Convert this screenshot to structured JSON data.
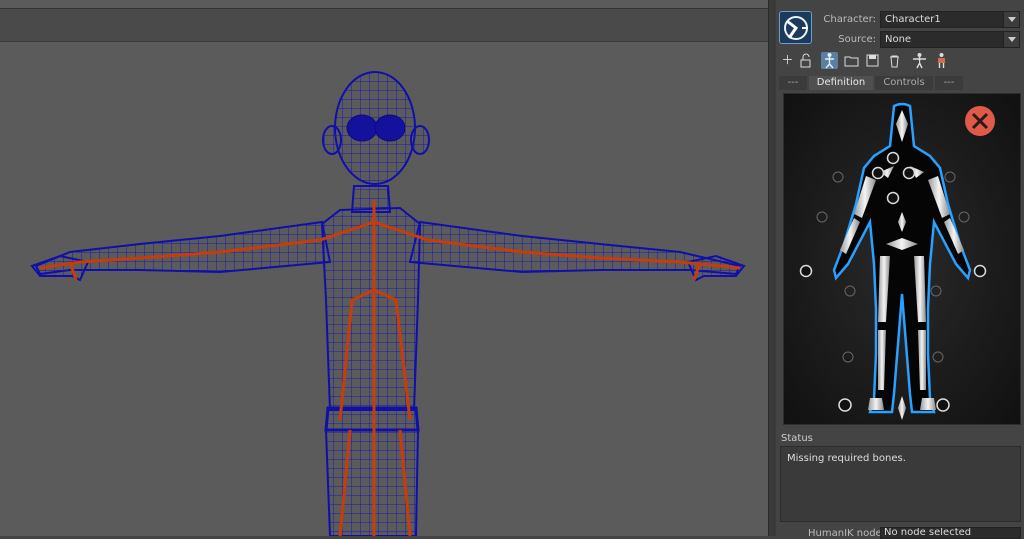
{
  "panel": {
    "character_label": "Character:",
    "character_value": "Character1",
    "source_label": "Source:",
    "source_value": "None",
    "toolbar": [
      "plus-icon",
      "lock-icon",
      "skeleton-definition-icon",
      "folder-open-icon",
      "save-icon",
      "delete-icon",
      "tpose-icon",
      "character-icon"
    ],
    "tabs": [
      {
        "label": "---",
        "active": false
      },
      {
        "label": "Definition",
        "active": true
      },
      {
        "label": "Controls",
        "active": false
      },
      {
        "label": "---",
        "active": false
      }
    ],
    "status_label": "Status",
    "status_text": "Missing required bones.",
    "hik_node_label": "HumanIK node",
    "hik_node_value": "No node selected"
  },
  "colors": {
    "mesh": "#1010a8",
    "bone": "#c83c0a",
    "figure_glow": "#2aa0ff",
    "close": "#e05a4a",
    "active_tool": "#5a7fa3"
  }
}
